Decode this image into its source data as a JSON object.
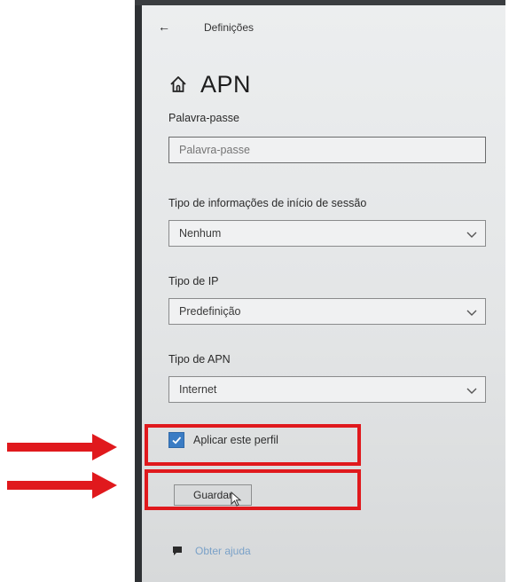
{
  "window": {
    "back_glyph": "←",
    "title": "Definições"
  },
  "page": {
    "heading": "APN",
    "home_icon": "home-icon"
  },
  "password": {
    "label": "Palavra-passe",
    "placeholder": "Palavra-passe"
  },
  "signin_type": {
    "label": "Tipo de informações de início de sessão",
    "value": "Nenhum"
  },
  "ip_type": {
    "label": "Tipo de IP",
    "value": "Predefinição"
  },
  "apn_type": {
    "label": "Tipo de APN",
    "value": "Internet"
  },
  "apply_profile": {
    "label": "Aplicar este perfil",
    "checked": true
  },
  "save_button": {
    "label": "Guardar"
  },
  "help": {
    "label": "Obter ajuda",
    "icon": "help-chat-icon"
  },
  "colors": {
    "annotation": "#e0191d",
    "accent": "#3a7cc4",
    "link": "#7aa1c8"
  }
}
